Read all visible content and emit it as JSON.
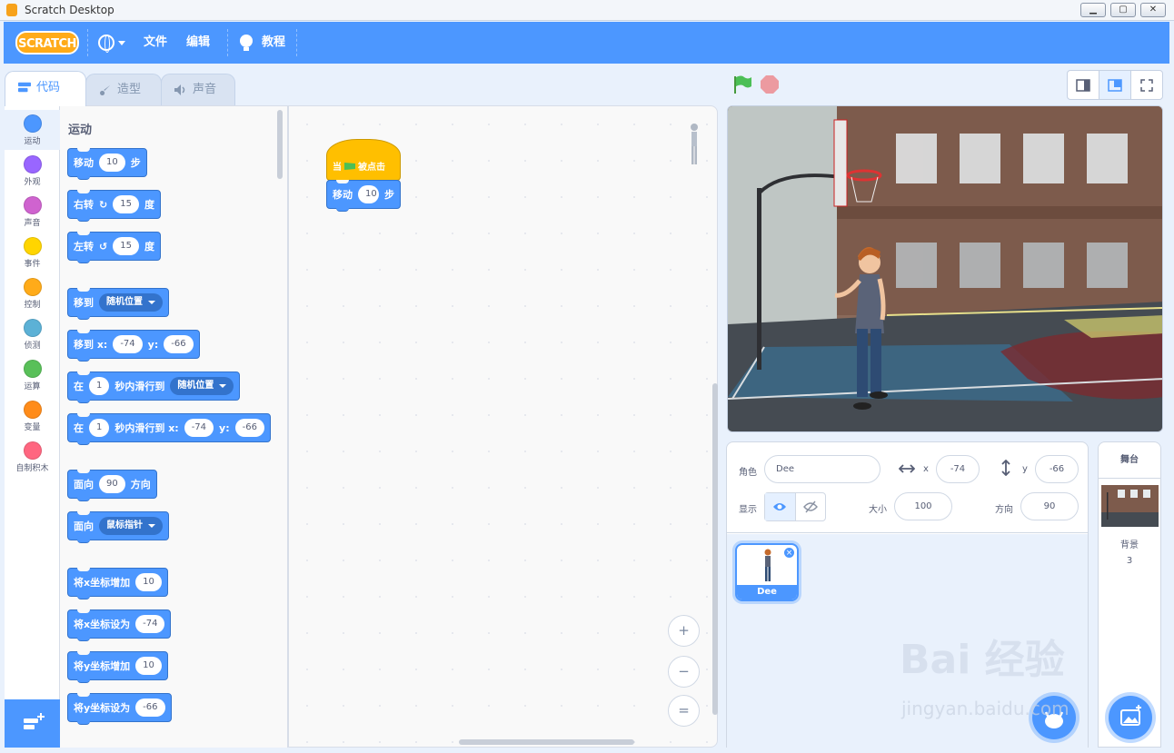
{
  "window": {
    "title": "Scratch Desktop",
    "min": "▁",
    "max": "▢",
    "close": "✕"
  },
  "menu": {
    "logo": "SCRATCH",
    "file": "文件",
    "edit": "编辑",
    "tutorials": "教程"
  },
  "tabs": {
    "code": "代码",
    "costumes": "造型",
    "sounds": "声音"
  },
  "categories": [
    {
      "label": "运动",
      "color": "#4c97ff"
    },
    {
      "label": "外观",
      "color": "#9966ff"
    },
    {
      "label": "声音",
      "color": "#cf63cf"
    },
    {
      "label": "事件",
      "color": "#ffd500"
    },
    {
      "label": "控制",
      "color": "#ffab19"
    },
    {
      "label": "侦测",
      "color": "#5cb1d6"
    },
    {
      "label": "运算",
      "color": "#59c059"
    },
    {
      "label": "变量",
      "color": "#ff8c1a"
    },
    {
      "label": "自制积木",
      "color": "#ff6680"
    }
  ],
  "palette": {
    "heading": "运动",
    "move": {
      "label": "移动",
      "val": "10",
      "unit": "步"
    },
    "turn_right": {
      "label": "右转",
      "val": "15",
      "unit": "度"
    },
    "turn_left": {
      "label": "左转",
      "val": "15",
      "unit": "度"
    },
    "goto": {
      "label": "移到",
      "dd": "随机位置"
    },
    "goto_xy": {
      "label": "移到 x:",
      "x": "-74",
      "ylabel": "y:",
      "y": "-66"
    },
    "glide": {
      "a": "在",
      "secs": "1",
      "b": "秒内滑行到",
      "dd": "随机位置"
    },
    "glide_xy": {
      "a": "在",
      "secs": "1",
      "b": "秒内滑行到 x:",
      "x": "-74",
      "ylabel": "y:",
      "y": "-66"
    },
    "point": {
      "label": "面向",
      "val": "90",
      "unit": "方向"
    },
    "point_towards": {
      "label": "面向",
      "dd": "鼠标指针"
    },
    "change_x": {
      "label": "将x坐标增加",
      "val": "10"
    },
    "set_x": {
      "label": "将x坐标设为",
      "val": "-74"
    },
    "change_y": {
      "label": "将y坐标增加",
      "val": "10"
    },
    "set_y": {
      "label": "将y坐标设为",
      "val": "-66"
    }
  },
  "script": {
    "hat_a": "当",
    "hat_b": "被点击",
    "move_label": "移动",
    "move_val": "10",
    "move_unit": "步"
  },
  "zoom": {
    "in": "+",
    "out": "−",
    "reset": "="
  },
  "sprite_info": {
    "sprite_label": "角色",
    "sprite_name": "Dee",
    "x_label": "x",
    "x": "-74",
    "y_label": "y",
    "y": "-66",
    "show_label": "显示",
    "size_label": "大小",
    "size": "100",
    "direction_label": "方向",
    "direction": "90"
  },
  "sprites": [
    {
      "name": "Dee",
      "delete": "×"
    }
  ],
  "stage_panel": {
    "title": "舞台",
    "backdrops_label": "背景",
    "backdrops_count": "3"
  },
  "watermark": {
    "line1": "Bai 经验",
    "line2": "jingyan.baidu.com"
  }
}
